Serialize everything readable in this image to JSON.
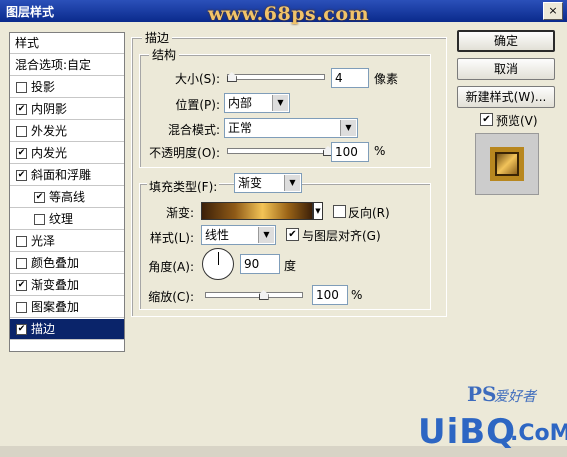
{
  "window": {
    "title": "图层样式",
    "watermark_top": "www.68ps.com",
    "close_label": "×"
  },
  "sidebar": {
    "header": "样式",
    "blend_options": "混合选项:自定",
    "items": [
      {
        "label": "投影",
        "checked": false
      },
      {
        "label": "内阴影",
        "checked": true
      },
      {
        "label": "外发光",
        "checked": false
      },
      {
        "label": "内发光",
        "checked": true
      },
      {
        "label": "斜面和浮雕",
        "checked": true
      },
      {
        "label": "等高线",
        "checked": true
      },
      {
        "label": "纹理",
        "checked": false
      },
      {
        "label": "光泽",
        "checked": false
      },
      {
        "label": "颜色叠加",
        "checked": false
      },
      {
        "label": "渐变叠加",
        "checked": true
      },
      {
        "label": "图案叠加",
        "checked": false
      },
      {
        "label": "描边",
        "checked": true
      }
    ]
  },
  "stroke": {
    "title": "描边",
    "structure": {
      "title": "结构",
      "size_label": "大小(S):",
      "size_value": "4",
      "size_unit": "像素",
      "position_label": "位置(P):",
      "position_value": "内部",
      "blend_label": "混合模式:",
      "blend_value": "正常",
      "opacity_label": "不透明度(O):",
      "opacity_value": "100",
      "opacity_unit": "%"
    },
    "fill": {
      "fill_type_label": "填充类型(F):",
      "fill_type_value": "渐变",
      "gradient_label": "渐变:",
      "reverse_label": "反向(R)",
      "style_label": "样式(L):",
      "style_value": "线性",
      "align_label": "与图层对齐(G)",
      "angle_label": "角度(A):",
      "angle_value": "90",
      "angle_unit": "度",
      "scale_label": "缩放(C):",
      "scale_value": "100",
      "scale_unit": "%"
    }
  },
  "buttons": {
    "ok": "确定",
    "cancel": "取消",
    "new_style": "新建样式(W)...",
    "preview": "预览(V)"
  },
  "footer_watermark": {
    "ps": "PS",
    "site_cn": "爱好者",
    "uibq": "UiBQ",
    "com": ".CoM"
  },
  "slider_levels": {
    "size": 0.04,
    "opacity": 1.0,
    "scale": 0.6
  }
}
